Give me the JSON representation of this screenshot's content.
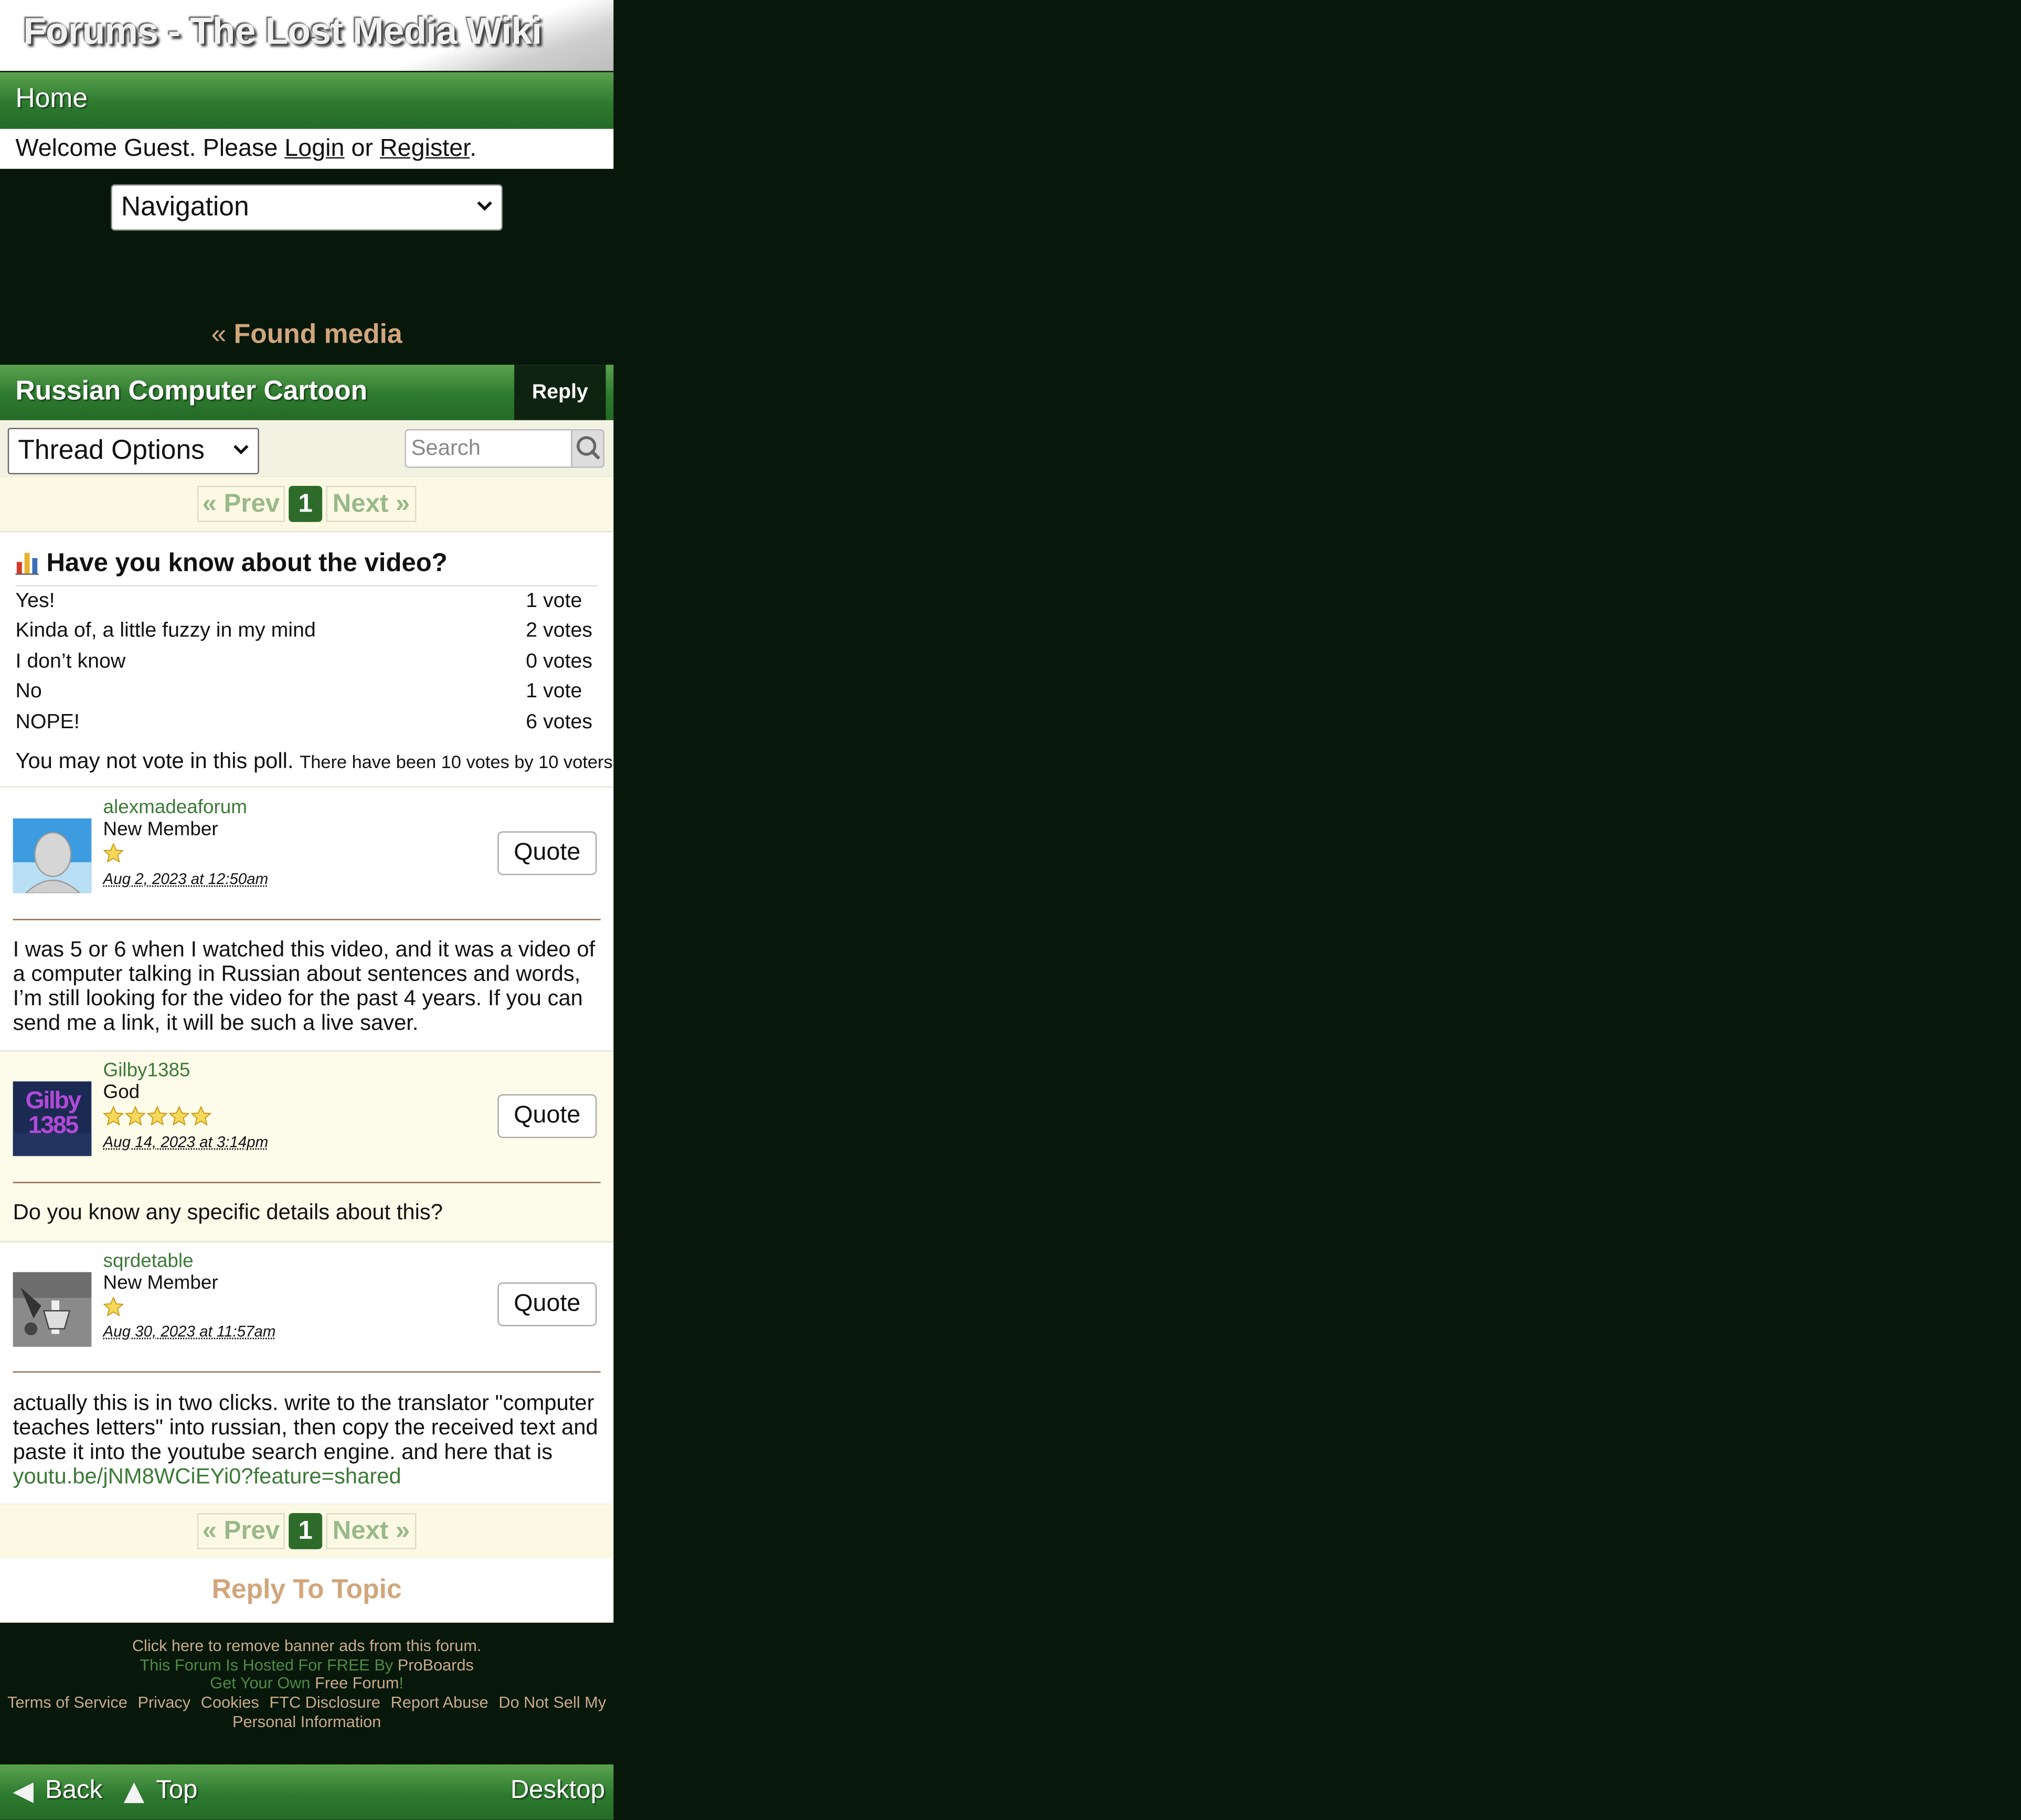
{
  "header": {
    "banner_title": "Forums - The Lost Media Wiki",
    "home_label": "Home",
    "welcome": {
      "prefix": "Welcome Guest. Please ",
      "login": "Login",
      "or": " or ",
      "register": "Register",
      "suffix": "."
    },
    "navigation_select": "Navigation"
  },
  "breadcrumb": {
    "arrow": "«",
    "label": "Found media"
  },
  "thread": {
    "title": "Russian Computer Cartoon",
    "reply_label": "Reply",
    "options_select": "Thread Options",
    "search_placeholder": "Search"
  },
  "pagination": {
    "prev": "« Prev",
    "current": "1",
    "next": "Next »"
  },
  "poll": {
    "question": "Have you know about the video?",
    "options": [
      {
        "label": "Yes!",
        "votes": "1 vote"
      },
      {
        "label": "Kinda of, a little fuzzy in my mind",
        "votes": "2 votes"
      },
      {
        "label": "I don’t know",
        "votes": "0 votes"
      },
      {
        "label": "No",
        "votes": "1 vote"
      },
      {
        "label": "NOPE!",
        "votes": "6 votes"
      }
    ],
    "notice": "You may not vote in this poll.",
    "summary": "There have been 10 votes by 10 voters."
  },
  "posts": [
    {
      "username": "alexmadeaforum",
      "rank": "New Member",
      "stars": 1,
      "date": "Aug 2, 2023 at 12:50am",
      "quote_label": "Quote",
      "body": "I was 5 or 6 when I watched this video, and it was a video of a computer talking in Russian about sentences and words, I’m still looking for the video for the past 4 years. If you can send me a link, it will be such a live saver."
    },
    {
      "username": "Gilby1385",
      "rank": "God",
      "stars": 5,
      "date": "Aug 14, 2023 at 3:14pm",
      "quote_label": "Quote",
      "avatar_text": "Gilby 1385",
      "body": "Do you know any specific details about this?"
    },
    {
      "username": "sqrdetable",
      "rank": "New Member",
      "stars": 1,
      "date": "Aug 30, 2023 at 11:57am",
      "quote_label": "Quote",
      "body": "actually this is in two clicks. write to the translator \"computer teaches letters\" into russian, then copy the received text and paste it into the youtube search engine. and here that is",
      "link": "youtu.be/jNM8WCiEYi0?feature=shared"
    }
  ],
  "reply_to_topic": "Reply To Topic",
  "footer": {
    "remove_ads": "Click here to remove banner ads from this forum.",
    "hosted_prefix": "This Forum Is Hosted For FREE By ",
    "hosted_link": "ProBoards",
    "own_prefix": "Get Your Own ",
    "own_link": "Free Forum",
    "own_suffix": "!",
    "links": [
      "Terms of Service",
      "Privacy",
      "Cookies",
      "FTC Disclosure",
      "Report Abuse",
      "Do Not Sell My"
    ],
    "links_line2": "Personal Information"
  },
  "bottom_bar": {
    "back": "Back",
    "top": "Top",
    "desktop": "Desktop"
  },
  "colors": {
    "page_background": "#07170a",
    "green_bar": "#2d7a2f",
    "tan_link": "#d1a67c",
    "post_alt_background": "#fdfcea"
  }
}
